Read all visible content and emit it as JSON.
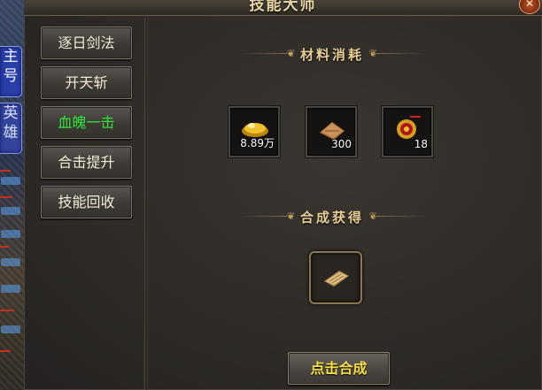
{
  "window": {
    "title": "技能大师"
  },
  "sidebar_tabs": [
    {
      "label": "主号"
    },
    {
      "label": "英雄"
    }
  ],
  "nav": {
    "items": [
      {
        "label": "逐日剑法",
        "active": false
      },
      {
        "label": "开天斩",
        "active": false
      },
      {
        "label": "血魄一击",
        "active": true
      },
      {
        "label": "合击提升",
        "active": false
      },
      {
        "label": "技能回收",
        "active": false
      }
    ]
  },
  "materials": {
    "header": "材料消耗",
    "items": [
      {
        "icon": "gold-ingot-icon",
        "quantity": "8.89万"
      },
      {
        "icon": "scroll-bundle-icon",
        "quantity": "300"
      },
      {
        "icon": "red-medallion-icon",
        "quantity": "18"
      }
    ]
  },
  "result": {
    "header": "合成获得",
    "icon": "skill-book-icon"
  },
  "compose_button": {
    "label": "点击合成"
  },
  "colors": {
    "active_nav_text": "#2fe63a",
    "compose_text": "#f7df4a",
    "header_text": "#e6cf95"
  }
}
